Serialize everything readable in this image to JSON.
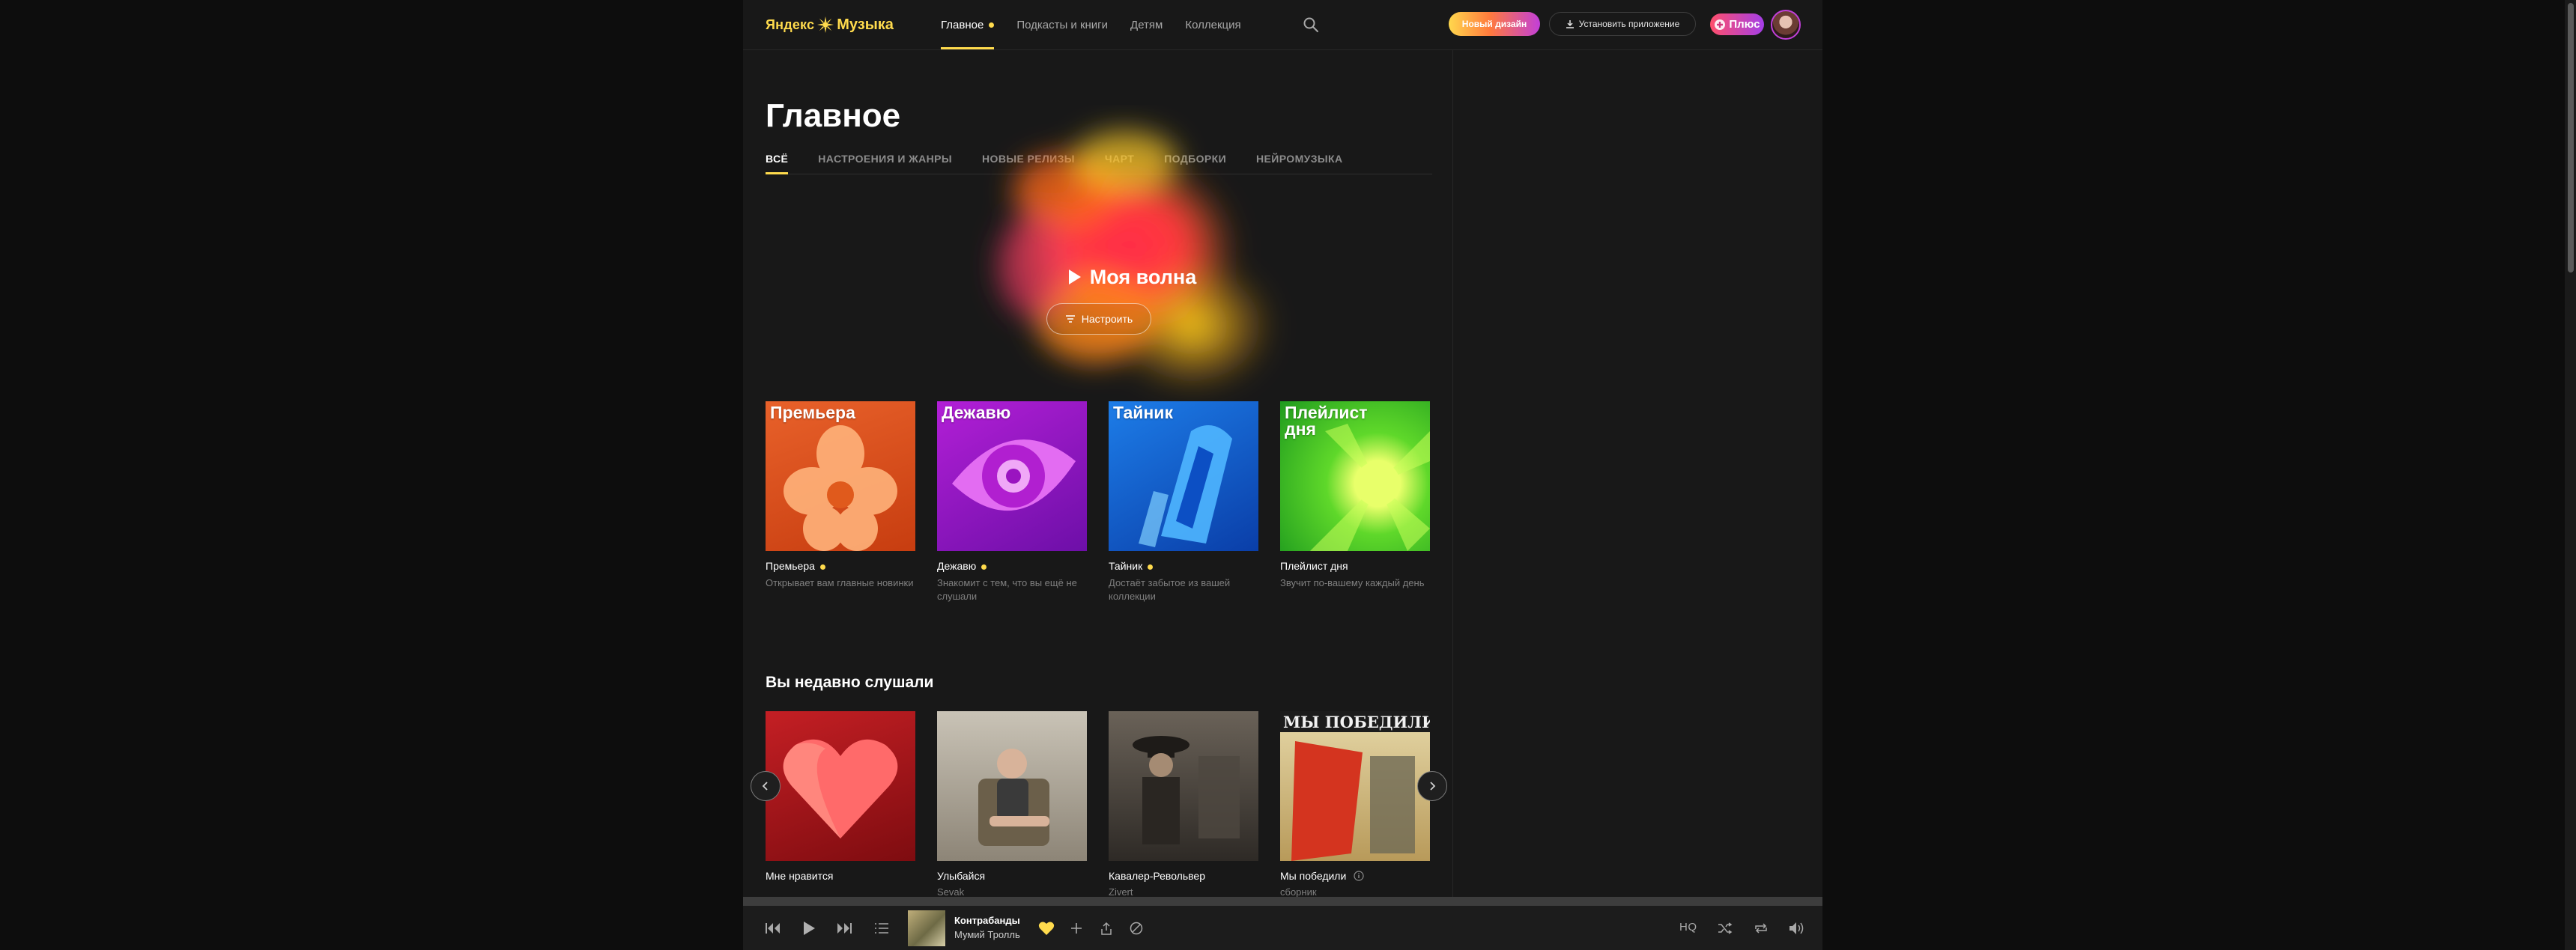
{
  "header": {
    "logo_ya": "Яндекс",
    "logo_music": "Музыка",
    "nav": [
      {
        "label": "Главное",
        "active": true,
        "dot": true
      },
      {
        "label": "Подкасты и книги",
        "active": false
      },
      {
        "label": "Детям",
        "active": false
      },
      {
        "label": "Коллекция",
        "active": false
      }
    ],
    "new_design_label": "Новый дизайн",
    "install_label": "Установить приложение",
    "plus_label": "Плюс"
  },
  "main": {
    "title": "Главное",
    "tabs": [
      "ВСЁ",
      "НАСТРОЕНИЯ И ЖАНРЫ",
      "НОВЫЕ РЕЛИЗЫ",
      "ЧАРТ",
      "ПОДБОРКИ",
      "НЕЙРОМУЗЫКА"
    ],
    "wave": {
      "title": "Моя волна",
      "tune_label": "Настроить"
    },
    "playlists": [
      {
        "cover_label": "Премьера",
        "title": "Премьера",
        "dot": true,
        "desc": "Открывает вам главные новинки"
      },
      {
        "cover_label": "Дежавю",
        "title": "Дежавю",
        "dot": true,
        "desc": "Знакомит с тем, что вы ещё не слушали"
      },
      {
        "cover_label": "Тайник",
        "title": "Тайник",
        "dot": true,
        "desc": "Достаёт забытое из вашей коллекции"
      },
      {
        "cover_label": "Плейлист дня",
        "title": "Плейлист дня",
        "dot": false,
        "desc": "Звучит по-вашему каждый день"
      }
    ],
    "recent_title": "Вы недавно слушали",
    "recent": [
      {
        "title": "Мне нравится",
        "sub": ""
      },
      {
        "title": "Улыбайся",
        "sub": "Sevak"
      },
      {
        "title": "Кавалер-Револьвер",
        "sub": "Zivert"
      },
      {
        "title": "Мы победили",
        "sub": "сборник",
        "cover_text": "МЫ ПОБЕДИЛИ"
      }
    ]
  },
  "player": {
    "track": "Контрабанды",
    "artist": "Мумий Тролль",
    "quality": "HQ"
  },
  "colors": {
    "accent": "#ffdb4d",
    "background": "#181818",
    "page": "#0d0d0d"
  }
}
